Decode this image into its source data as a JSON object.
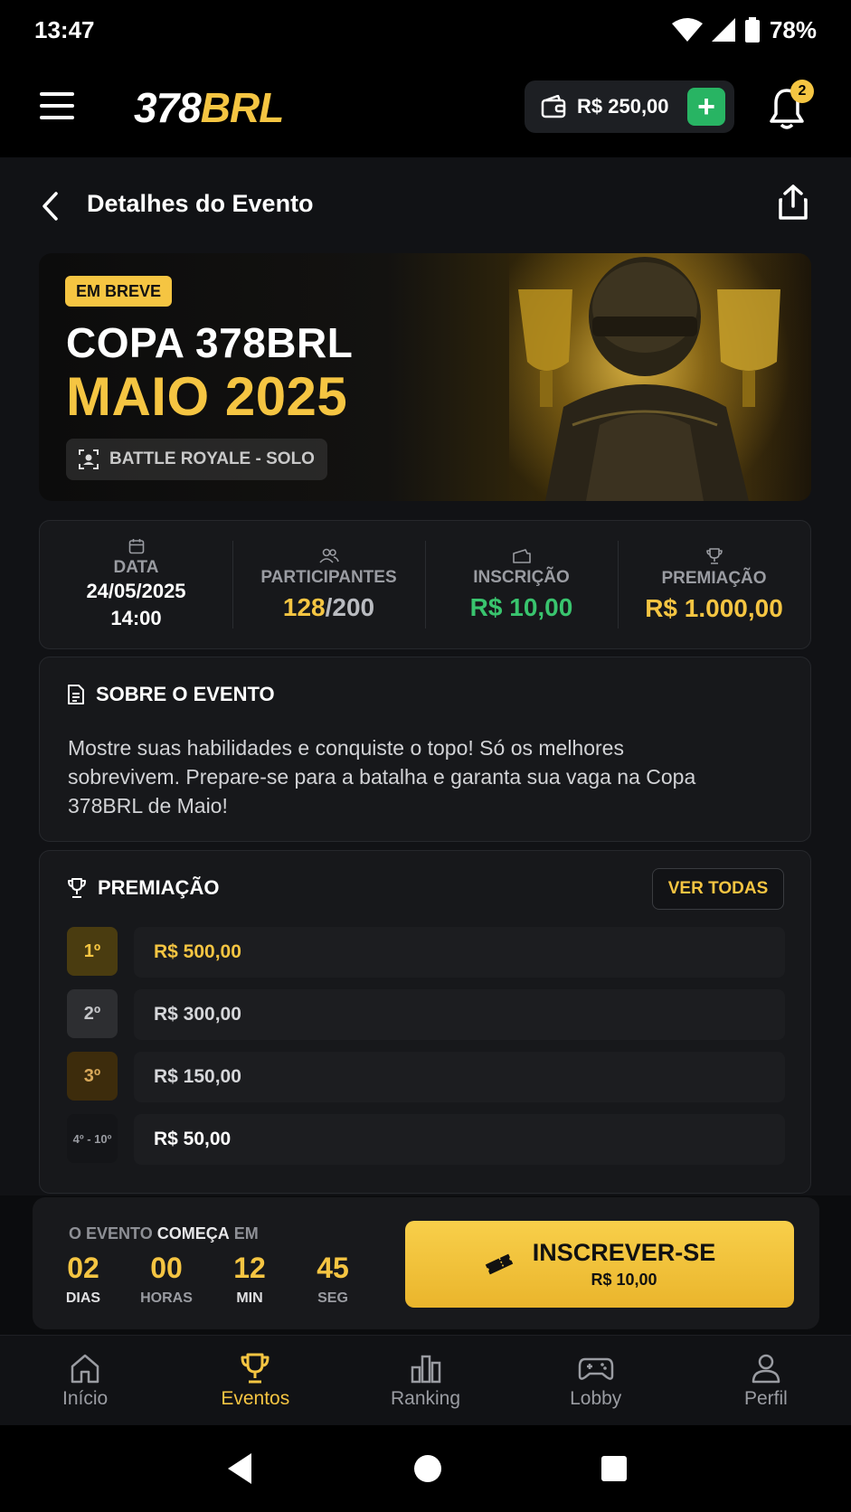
{
  "status_bar": {
    "time": "13:47",
    "battery": "78%"
  },
  "header": {
    "logo_number": "378",
    "logo_brand": "BRL",
    "wallet_balance": "R$ 250,00",
    "wallet_add": "+",
    "notification_count": "2",
    "icons": [
      "menu-icon",
      "wallet-icon",
      "plus-icon",
      "bell-icon"
    ]
  },
  "page": {
    "title": "Detalhes do Evento",
    "icons": [
      "back-icon",
      "share-icon"
    ]
  },
  "hero": {
    "badge": "EM BREVE",
    "title_line1": "COPA 378BRL",
    "title_line2": "MAIO 2025",
    "mode": "BATTLE ROYALE - SOLO"
  },
  "stats": {
    "date_label": "DATA",
    "date_value": "24/05/2025",
    "time_value": "14:00",
    "participants_label": "PARTICIPANTES",
    "participants_current": "128",
    "participants_sep": "/",
    "participants_max": "200",
    "fee_label": "INSCRIÇÃO",
    "fee_value": "R$ 10,00",
    "prize_label": "PREMIAÇÃO",
    "prize_value": "R$ 1.000,00"
  },
  "about": {
    "title": "SOBRE O EVENTO",
    "text": "Mostre suas habilidades e conquiste o topo! Só os melhores sobrevivem. Prepare-se para a batalha e garanta sua vaga na Copa 378BRL de Maio!"
  },
  "prizes": {
    "title": "PREMIAÇÃO",
    "see_all": "VER TODAS",
    "rows": [
      {
        "rank": "1º",
        "amount": "R$ 500,00"
      },
      {
        "rank": "2º",
        "amount": "R$ 300,00"
      },
      {
        "rank": "3º",
        "amount": "R$ 150,00"
      },
      {
        "rank": "4º - 10º",
        "amount": "R$ 50,00"
      }
    ]
  },
  "countdown": {
    "label_a": "O EVENTO ",
    "label_b": "COMEÇA",
    "label_c": " EM",
    "days": "02",
    "days_label": "DIAS",
    "hours": "00",
    "hours_label": "HORAS",
    "minutes": "12",
    "minutes_label": "MIN",
    "seconds": "45",
    "seconds_label": "SEG"
  },
  "cta": {
    "label": "INSCREVER-SE",
    "price": "R$ 10,00"
  },
  "nav": [
    {
      "label": "Início",
      "icon": "home-icon"
    },
    {
      "label": "Eventos",
      "icon": "trophy-icon",
      "active": true
    },
    {
      "label": "Ranking",
      "icon": "bar-chart-icon"
    },
    {
      "label": "Lobby",
      "icon": "gamepad-icon"
    },
    {
      "label": "Perfil",
      "icon": "user-icon"
    }
  ],
  "colors": {
    "accent": "#f5c542",
    "green": "#39c46e",
    "background": "#111215"
  }
}
